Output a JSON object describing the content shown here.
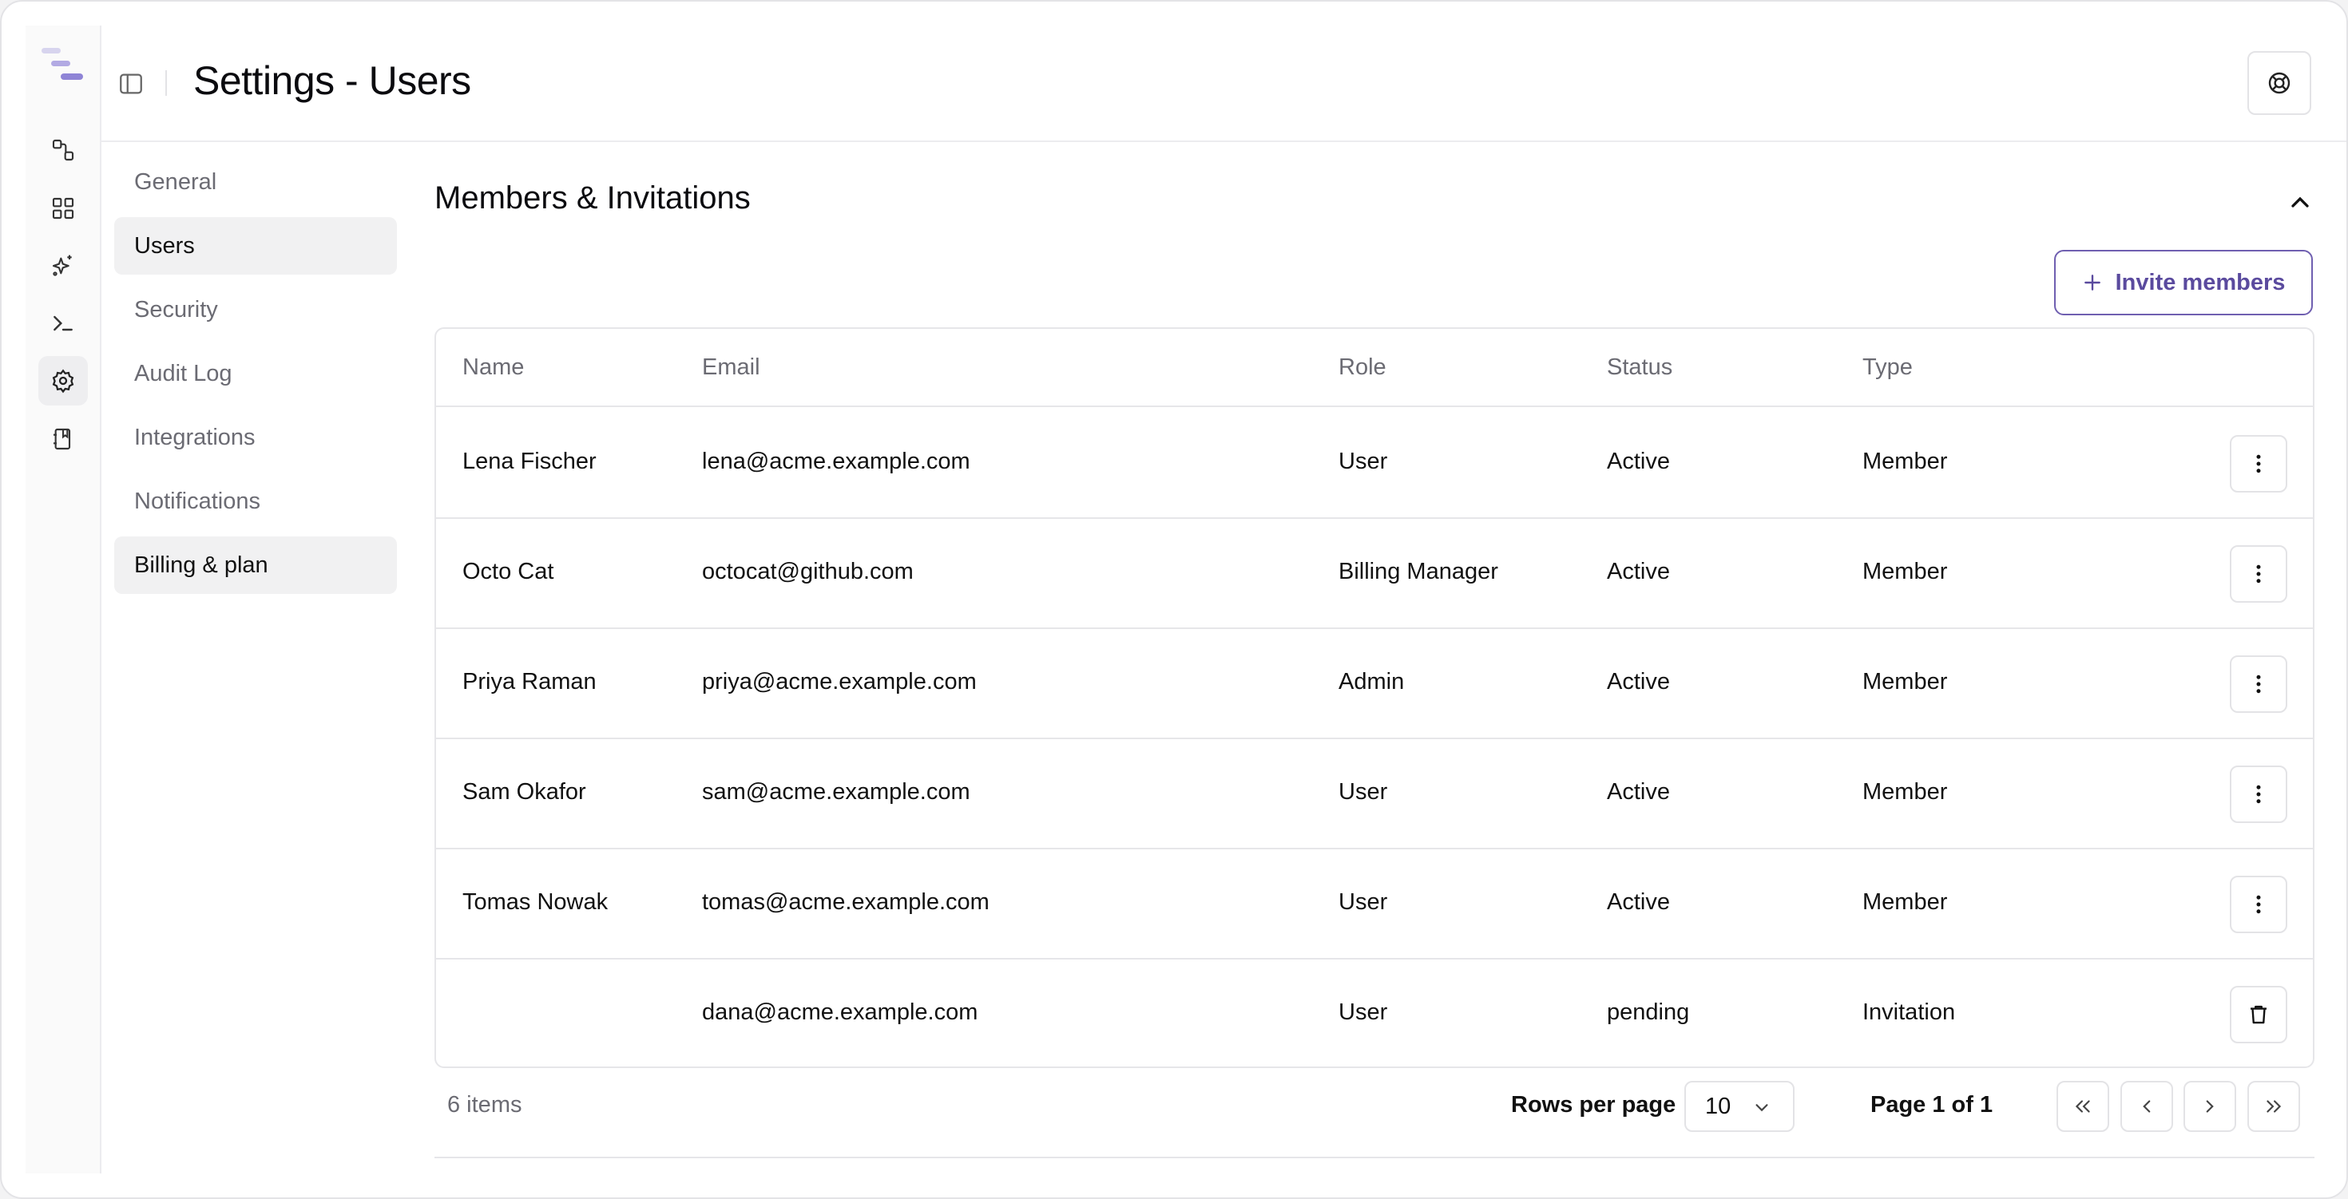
{
  "header": {
    "title": "Settings - Users"
  },
  "rail": {
    "items": [
      {
        "icon": "workflow-icon"
      },
      {
        "icon": "dashboard-icon"
      },
      {
        "icon": "sparkles-icon"
      },
      {
        "icon": "terminal-icon"
      },
      {
        "icon": "gear-icon",
        "active": true
      },
      {
        "icon": "notebook-icon"
      }
    ]
  },
  "settings_nav": {
    "items": [
      {
        "label": "General"
      },
      {
        "label": "Users",
        "selected": true
      },
      {
        "label": "Security"
      },
      {
        "label": "Audit Log"
      },
      {
        "label": "Integrations"
      },
      {
        "label": "Notifications"
      },
      {
        "label": "Billing & plan"
      }
    ]
  },
  "section": {
    "title": "Members & Invitations",
    "invite_label": "Invite members"
  },
  "table": {
    "columns": [
      "Name",
      "Email",
      "Role",
      "Status",
      "Type"
    ],
    "rows": [
      {
        "name": "Lena Fischer",
        "email": "lena@acme.example.com",
        "role": "User",
        "status": "Active",
        "type": "Member",
        "action": "more-icon"
      },
      {
        "name": "Octo Cat",
        "email": "octocat@github.com",
        "role": "Billing Manager",
        "status": "Active",
        "type": "Member",
        "action": "more-icon"
      },
      {
        "name": "Priya Raman",
        "email": "priya@acme.example.com",
        "role": "Admin",
        "status": "Active",
        "type": "Member",
        "action": "more-icon"
      },
      {
        "name": "Sam Okafor",
        "email": "sam@acme.example.com",
        "role": "User",
        "status": "Active",
        "type": "Member",
        "action": "more-icon"
      },
      {
        "name": "Tomas Nowak",
        "email": "tomas@acme.example.com",
        "role": "User",
        "status": "Active",
        "type": "Member",
        "action": "more-icon"
      },
      {
        "name": "",
        "email": "dana@acme.example.com",
        "role": "User",
        "status": "pending",
        "type": "Invitation",
        "action": "trash-icon"
      }
    ]
  },
  "pagination": {
    "items_count": "6 items",
    "rows_per_page_label": "Rows per page",
    "rows_per_page_value": "10",
    "page_label": "Page 1 of 1"
  },
  "colors": {
    "accent": "#5a4a9e",
    "logo": "#8f84d6",
    "border": "#e6e6e9"
  }
}
